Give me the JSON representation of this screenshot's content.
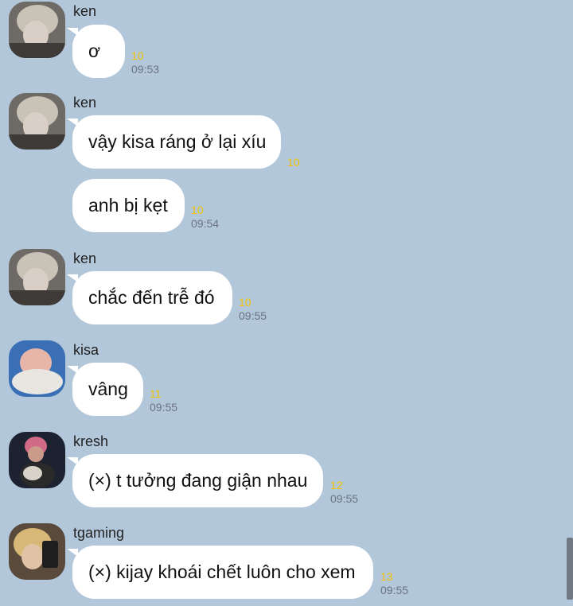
{
  "colors": {
    "background": "#b2c7da",
    "bubble": "#ffffff",
    "unread_count": "#f2c200",
    "timestamp": "#6b7480"
  },
  "messages": [
    {
      "sender": "ken",
      "text": "ơ",
      "unread": "10",
      "time": "09:53"
    },
    {
      "sender": "ken",
      "text": "vậy kisa ráng ở lại xíu",
      "unread": "10",
      "time": ""
    },
    {
      "sender": "",
      "text": "anh bị kẹt",
      "unread": "10",
      "time": "09:54"
    },
    {
      "sender": "ken",
      "text": "chắc đến trễ đó",
      "unread": "10",
      "time": "09:55"
    },
    {
      "sender": "kisa",
      "text": "vâng",
      "unread": "11",
      "time": "09:55"
    },
    {
      "sender": "kresh",
      "text": "(×) t tưởng đang giận nhau",
      "unread": "12",
      "time": "09:55"
    },
    {
      "sender": "tgaming",
      "text": "(×) kijay khoái chết luôn cho xem",
      "unread": "13",
      "time": "09:55"
    }
  ],
  "avatars": [
    "profile-photo-icon",
    "profile-photo-icon",
    "profile-photo-icon",
    "profile-photo-icon",
    "profile-photo-icon",
    "profile-photo-icon"
  ]
}
